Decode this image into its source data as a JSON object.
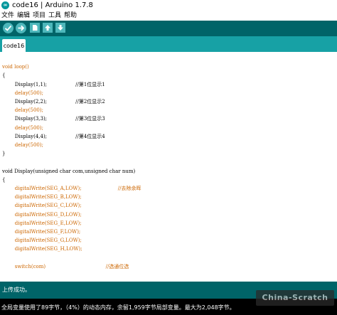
{
  "window": {
    "title": "code16 | Arduino 1.7.8",
    "logo_text": "∞",
    "logo_icon": "arduino-logo-icon"
  },
  "menu": {
    "items": [
      "文件",
      "编辑",
      "项目",
      "工具",
      "帮助"
    ]
  },
  "toolbar": {
    "buttons": [
      {
        "icon": "verify-check-icon"
      },
      {
        "icon": "upload-arrow-icon"
      },
      {
        "icon": "new-file-icon"
      },
      {
        "icon": "open-up-arrow-icon"
      },
      {
        "icon": "save-down-arrow-icon"
      }
    ],
    "accent_color": "#4db7bb",
    "background_color": "#006468"
  },
  "tabs": [
    {
      "label": "code16",
      "active": true
    }
  ],
  "editor": {
    "lines": [
      {
        "text": "",
        "color": "#000000"
      },
      {
        "text": "void loop()",
        "color": "#cc6600"
      },
      {
        "text": "{",
        "color": "#000000"
      },
      {
        "text": "        Display(1,1);                  //第1位显示1",
        "color": "#000000"
      },
      {
        "text": "        delay(500);",
        "color": "#cc6600"
      },
      {
        "text": "        Display(2,2);                  //第2位显示2",
        "color": "#000000"
      },
      {
        "text": "        delay(500);",
        "color": "#cc6600"
      },
      {
        "text": "        Display(3,3);                  //第3位显示3",
        "color": "#000000"
      },
      {
        "text": "        delay(500);",
        "color": "#cc6600"
      },
      {
        "text": "        Display(4,4);                  //第4位显示4",
        "color": "#000000"
      },
      {
        "text": "        delay(500);",
        "color": "#cc6600"
      },
      {
        "text": "}",
        "color": "#000000"
      },
      {
        "text": "",
        "color": "#000000"
      },
      {
        "text": "void Display(unsigned char com,unsigned char num)",
        "color": "#000000"
      },
      {
        "text": "{",
        "color": "#000000"
      },
      {
        "text": "        digitalWrite(SEG_A,LOW);                       //去除余晖",
        "color": "#cc6600"
      },
      {
        "text": "        digitalWrite(SEG_B,LOW);",
        "color": "#cc6600"
      },
      {
        "text": "        digitalWrite(SEG_C,LOW);",
        "color": "#cc6600"
      },
      {
        "text": "        digitalWrite(SEG_D,LOW);",
        "color": "#cc6600"
      },
      {
        "text": "        digitalWrite(SEG_E,LOW);",
        "color": "#cc6600"
      },
      {
        "text": "        digitalWrite(SEG_F,LOW);",
        "color": "#cc6600"
      },
      {
        "text": "        digitalWrite(SEG_G,LOW);",
        "color": "#cc6600"
      },
      {
        "text": "        digitalWrite(SEG_H,LOW);",
        "color": "#cc6600"
      },
      {
        "text": "",
        "color": "#000000"
      },
      {
        "text": "        switch(com)                                      //选通位选",
        "color": "#cc6600"
      }
    ]
  },
  "status": {
    "message": "上传成功。"
  },
  "console": {
    "message": "全局变量使用了89字节，（4%）的动态内存，余留1,959字节局部变量。最大为2,048字节。"
  },
  "watermark": {
    "text": "China-Scratch"
  }
}
